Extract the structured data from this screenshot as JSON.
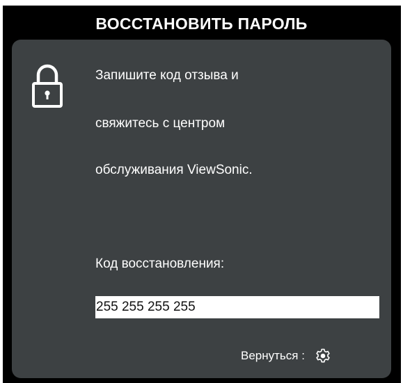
{
  "dialog": {
    "title": "ВОССТАНОВИТЬ ПАРОЛЬ",
    "lock_icon": "lock-icon",
    "message_lines": [
      "Запишите код отзыва и",
      "свяжитесь с центром",
      "обслуживания ViewSonic."
    ],
    "recovery_code_label": "Код восстановления:",
    "recovery_code_value": "255 255 255 255",
    "back_label": "Вернуться :",
    "back_icon": "gear-icon"
  },
  "colors": {
    "background": "#000000",
    "panel": "#3d4143",
    "text": "#ffffff",
    "code_field": "#ffffff"
  }
}
